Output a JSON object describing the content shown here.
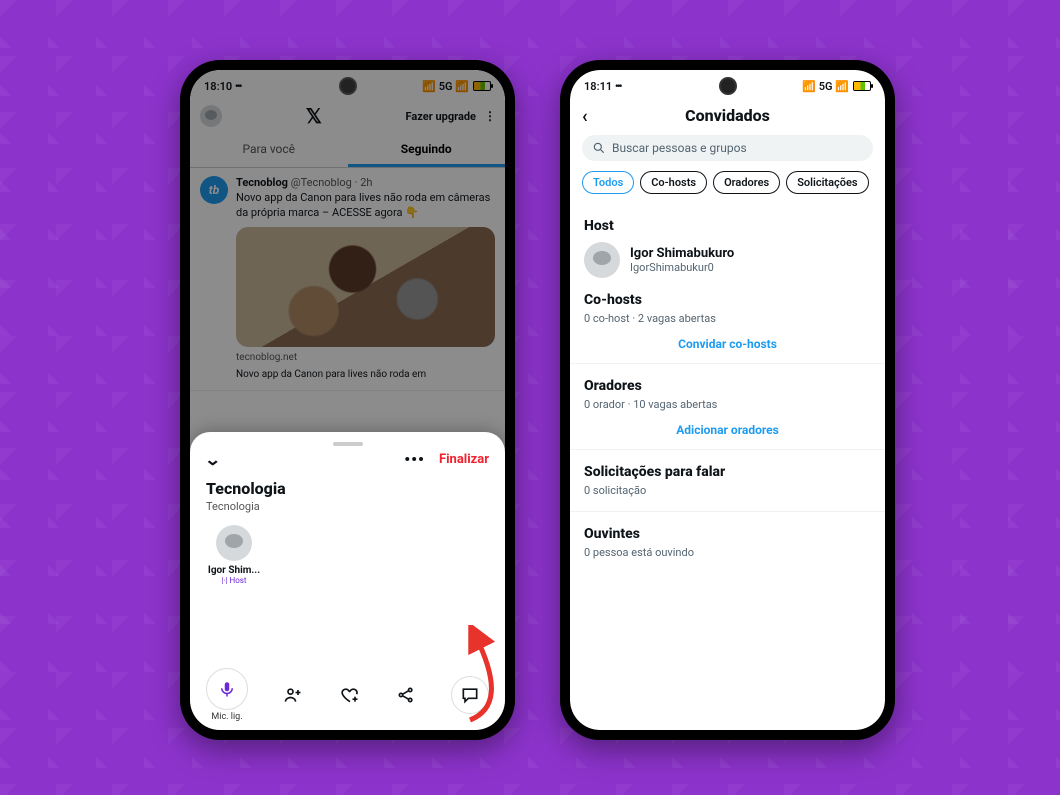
{
  "status": {
    "time_left": "18:10",
    "time_right": "18:11",
    "net_label": "5G",
    "signal_icon_text": "ıl"
  },
  "header": {
    "upgrade_label": "Fazer upgrade",
    "logo_glyph": "𝕏"
  },
  "tabs": {
    "for_you": "Para você",
    "following": "Seguindo"
  },
  "tweet": {
    "author_name": "Tecnoblog",
    "author_handle": "@Tecnoblog",
    "time": "2h",
    "text": "Novo app da Canon para lives não roda em câmeras da própria marca – ACESSE agora 👇",
    "card_domain": "tecnoblog.net",
    "card_title": "Novo app da Canon para lives não roda em"
  },
  "sheet": {
    "finalize_label": "Finalizar",
    "title": "Tecnologia",
    "category": "Tecnologia",
    "host_short": "Igor Shim...",
    "host_role": "Host",
    "mic_label": "Mic. lig."
  },
  "guests": {
    "page_title": "Convidados",
    "search_placeholder": "Buscar pessoas e grupos",
    "chips": [
      "Todos",
      "Co-hosts",
      "Oradores",
      "Solicitações"
    ],
    "host_section": "Host",
    "host_name": "Igor Shimabukuro",
    "host_handle": "IgorShimabukur0",
    "cohosts_section": "Co-hosts",
    "cohosts_sub": "0 co-host · 2 vagas abertas",
    "cohosts_action": "Convidar co-hosts",
    "speakers_section": "Oradores",
    "speakers_sub": "0 orador · 10 vagas abertas",
    "speakers_action": "Adicionar oradores",
    "requests_section": "Solicitações para falar",
    "requests_sub": "0 solicitação",
    "listeners_section": "Ouvintes",
    "listeners_sub": "0 pessoa está ouvindo"
  }
}
